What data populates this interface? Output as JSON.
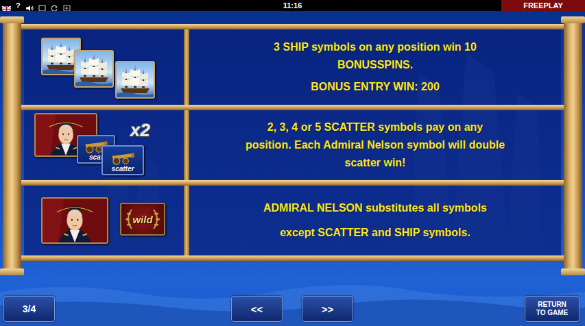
{
  "status_bar": {
    "help": "?",
    "time": "11:16",
    "mode": "FREEPLAY"
  },
  "rules": [
    {
      "kind": "ships",
      "lines": [
        "3 SHIP symbols on any position win 10",
        "BONUSSPINS.",
        "BONUS ENTRY WIN: 200"
      ]
    },
    {
      "kind": "scatter",
      "multiplier": "x2",
      "symbol_labels": [
        "scat",
        "scatter"
      ],
      "lines": [
        "2, 3, 4 or 5 SCATTER symbols pay on any",
        "position. Each Admiral Nelson symbol will double",
        "scatter win!"
      ]
    },
    {
      "kind": "wild",
      "symbol_labels": [
        "wild"
      ],
      "lines": [
        "ADMIRAL NELSON substitutes all symbols",
        "except SCATTER and SHIP symbols."
      ]
    }
  ],
  "navigation": {
    "page": "3/4",
    "prev": "<<",
    "next": ">>",
    "return_lines": [
      "RETURN",
      "TO GAME"
    ]
  }
}
